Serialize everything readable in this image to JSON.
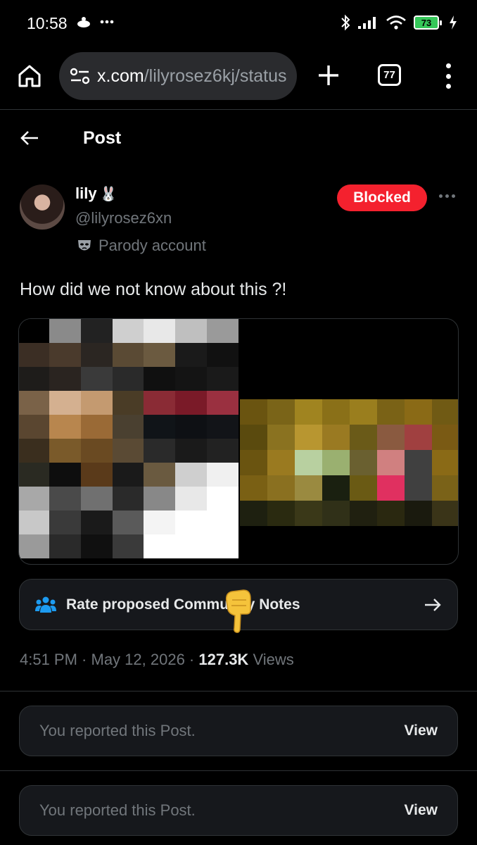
{
  "status_bar": {
    "time": "10:58",
    "battery": "73",
    "icons": [
      "notification-icon",
      "more-icon",
      "bluetooth-icon",
      "signal-icon",
      "wifi-icon",
      "battery-icon",
      "charging-icon"
    ]
  },
  "browser": {
    "url_host": "x.com",
    "url_path": "/lilyrosez6kj/status",
    "tab_count": "77"
  },
  "header": {
    "title": "Post"
  },
  "author": {
    "name": "lily",
    "name_emoji": "🐰",
    "handle": "@lilyrosez6xn",
    "label": "Parody account",
    "blocked_label": "Blocked"
  },
  "post": {
    "text": "How did we not know about this ?!"
  },
  "community_notes": {
    "label": "Rate proposed Community Notes"
  },
  "meta": {
    "time": "4:51 PM",
    "date": "May 12, 2026",
    "views_count": "127.3K",
    "views_label": "Views"
  },
  "reports": [
    {
      "text": "You reported this Post.",
      "action": "View"
    },
    {
      "text": "You reported this Post.",
      "action": "View"
    }
  ],
  "colors": {
    "background": "#000000",
    "blocked": "#f4212e",
    "muted_text": "#71767b",
    "card": "#16181c",
    "accent_blue": "#1d9bf0"
  }
}
